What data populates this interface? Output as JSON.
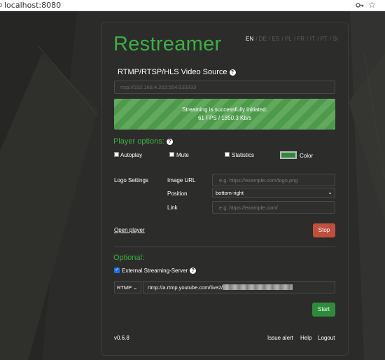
{
  "browser": {
    "url_prefix": "o",
    "url": "localhost:8080"
  },
  "app": {
    "title": "Restreamer",
    "languages": [
      "EN",
      "DE",
      "ES",
      "PL",
      "FR",
      "IT",
      "PT",
      "SI"
    ],
    "active_language": "EN"
  },
  "source": {
    "title": "RTMP/RTSP/HLS Video Source",
    "value": "rtsp://192.168.4.202:554/333333"
  },
  "status": {
    "line1": "Streaming is successfully initiated.",
    "line2": "61 FPS / 1850.3 Kb/s",
    "colors": {
      "stripe1": "#62a95f",
      "stripe2": "#4e9a4b"
    }
  },
  "player": {
    "title": "Player options:",
    "autoplay": "Autoplay",
    "mute": "Mute",
    "statistics": "Statistics",
    "color": "Color",
    "color_value": "#2e8b3c"
  },
  "logo": {
    "section": "Logo Settings",
    "image_url_label": "Image URL",
    "image_url_placeholder": "e.g. https://example.com/logo.png",
    "position_label": "Position",
    "position_value": "bottom-right",
    "link_label": "Link",
    "link_placeholder": "e.g. https://example.com/"
  },
  "actions": {
    "open_player": "Open player",
    "stop": "Stop",
    "start": "Start"
  },
  "optional": {
    "title": "Optional:",
    "external_label": "External Streaming-Server",
    "protocol": "RTMP",
    "rtmp_value": "rtmp://a.rtmp.youtube.com/live2/"
  },
  "footer": {
    "version": "v0.6.8",
    "issue": "Issue alert",
    "help": "Help",
    "logout": "Logout"
  },
  "colors": {
    "accent": "#3cb043",
    "stop": "#c0503c",
    "start": "#2e8b3c",
    "background": "#2b2b29"
  }
}
